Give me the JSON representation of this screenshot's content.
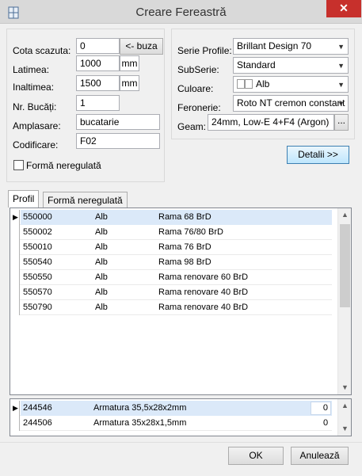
{
  "window": {
    "title": "Creare Fereastră",
    "close_glyph": "✕"
  },
  "left_form": {
    "cota_label": "Cota scazuta:",
    "cota_value": "0",
    "buza_button": "<- buza",
    "latime_label": "Latimea:",
    "latime_value": "1000",
    "latime_unit": "mm",
    "inaltime_label": "Inaltimea:",
    "inaltime_value": "1500",
    "inaltime_unit": "mm",
    "bucati_label": "Nr. Bucăți:",
    "bucati_value": "1",
    "amplasare_label": "Amplasare:",
    "amplasare_value": "bucatarie",
    "codificare_label": "Codificare:",
    "codificare_value": "F02",
    "forma_label": "Formă neregulată"
  },
  "right_form": {
    "serie_label": "Serie Profile:",
    "serie_value": "Brillant Design 70",
    "subserie_label": "SubSerie:",
    "subserie_value": "Standard",
    "culoare_label": "Culoare:",
    "culoare_value": "Alb",
    "feronerie_label": "Feronerie:",
    "feronerie_value": "Roto NT cremon constant",
    "geam_label": "Geam:",
    "geam_value": "24mm, Low-E 4+F4 (Argon)",
    "geam_button": "..."
  },
  "detalii_button": "Detalii >>",
  "tabs": [
    {
      "label": "Profil"
    },
    {
      "label": "Formă neregulată"
    }
  ],
  "profiles": [
    {
      "code": "550000",
      "color": "Alb",
      "name": "Rama 68 BrD"
    },
    {
      "code": "550002",
      "color": "Alb",
      "name": "Rama 76/80 BrD"
    },
    {
      "code": "550010",
      "color": "Alb",
      "name": "Rama 76 BrD"
    },
    {
      "code": "550540",
      "color": "Alb",
      "name": "Rama 98 BrD"
    },
    {
      "code": "550550",
      "color": "Alb",
      "name": "Rama renovare 60 BrD"
    },
    {
      "code": "550570",
      "color": "Alb",
      "name": "Rama renovare 40 BrD"
    },
    {
      "code": "550790",
      "color": "Alb",
      "name": "Rama renovare 40 BrD"
    }
  ],
  "armaturi": [
    {
      "code": "244546",
      "name": "Armatura 35,5x28x2mm",
      "qty": "0"
    },
    {
      "code": "244506",
      "name": "Armatura 35x28x1,5mm",
      "qty": "0"
    }
  ],
  "footer": {
    "ok_label": "OK",
    "cancel_label": "Anulează"
  },
  "colors": {
    "close": "#c7302c",
    "selection": "#dbe9f9",
    "default_button_border": "#3c7fb1"
  }
}
